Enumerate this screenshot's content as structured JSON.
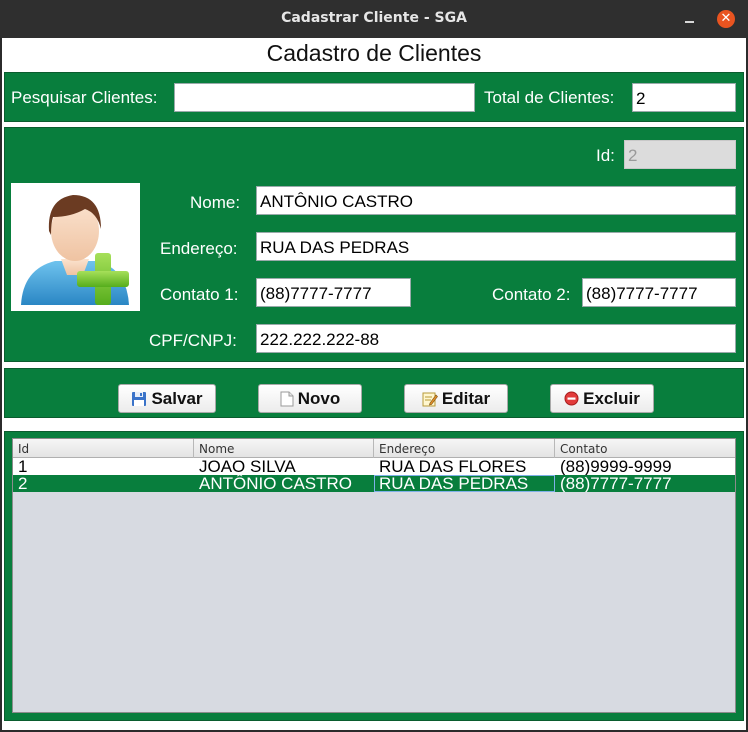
{
  "window": {
    "title": "Cadastrar Cliente - SGA",
    "close_glyph": "✕"
  },
  "heading": "Cadastro de Clientes",
  "search": {
    "label": "Pesquisar Clientes:",
    "value": "",
    "total_label": "Total de Clientes:",
    "total_value": "2"
  },
  "form": {
    "id_label": "Id:",
    "id_value": "2",
    "nome_label": "Nome:",
    "nome_value": "ANTÔNIO CASTRO",
    "endereco_label": "Endereço:",
    "endereco_value": "RUA DAS PEDRAS",
    "contato1_label": "Contato 1:",
    "contato1_value": "(88)7777-7777",
    "contato2_label": "Contato 2:",
    "contato2_value": "(88)7777-7777",
    "cpf_label": "CPF/CNPJ:",
    "cpf_value": "222.222.222-88",
    "avatar_icon": "add-user-icon"
  },
  "buttons": {
    "salvar": "Salvar",
    "salvar_icon": "floppy-disk-icon",
    "novo": "Novo",
    "novo_icon": "blank-page-icon",
    "editar": "Editar",
    "editar_icon": "edit-note-icon",
    "excluir": "Excluir",
    "excluir_icon": "delete-circle-icon"
  },
  "table": {
    "columns": [
      "Id",
      "Nome",
      "Endereço",
      "Contato"
    ],
    "rows": [
      [
        "1",
        "JOAO SILVA",
        "RUA DAS FLORES",
        "(88)9999-9999"
      ],
      [
        "2",
        "ANTÔNIO CASTRO",
        "RUA DAS PEDRAS",
        "(88)7777-7777"
      ]
    ],
    "selected_row": 2
  },
  "colors": {
    "panel": "#087e3d",
    "close_button": "#e95420",
    "table_bg": "#d7dae1"
  }
}
